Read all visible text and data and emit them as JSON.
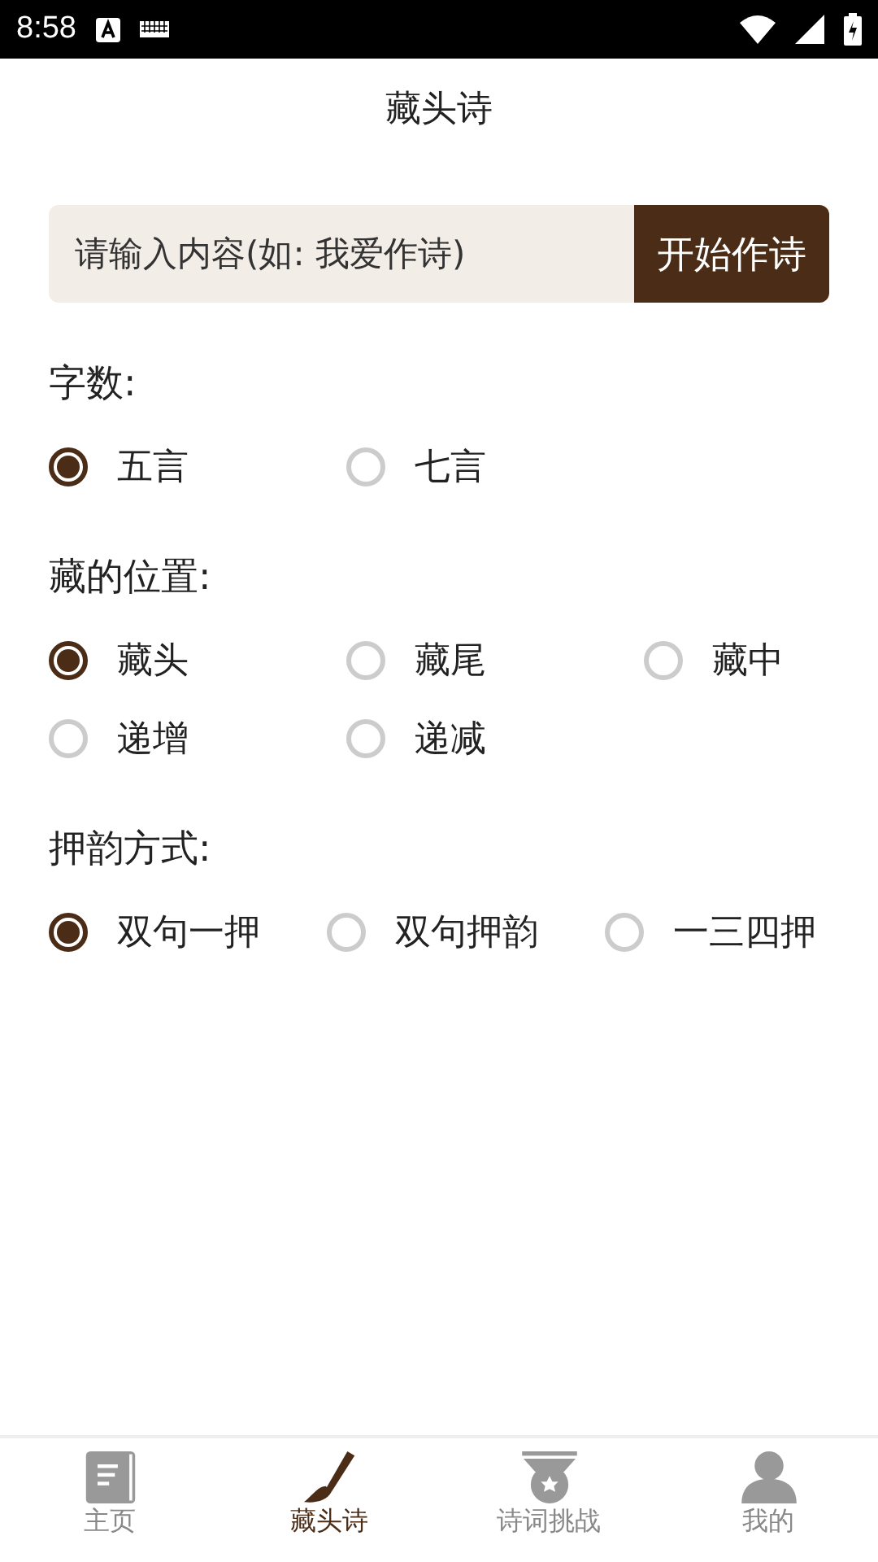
{
  "status_bar": {
    "time": "8:58"
  },
  "header": {
    "title": "藏头诗"
  },
  "input": {
    "placeholder": "请输入内容(如: 我爱作诗)",
    "button": "开始作诗"
  },
  "groups": [
    {
      "label": "字数:",
      "options": [
        {
          "label": "五言",
          "selected": true
        },
        {
          "label": "七言",
          "selected": false
        }
      ]
    },
    {
      "label": "藏的位置:",
      "options": [
        {
          "label": "藏头",
          "selected": true
        },
        {
          "label": "藏尾",
          "selected": false
        },
        {
          "label": "藏中",
          "selected": false
        },
        {
          "label": "递增",
          "selected": false
        },
        {
          "label": "递减",
          "selected": false
        }
      ]
    },
    {
      "label": "押韵方式:",
      "options": [
        {
          "label": "双句一押",
          "selected": true
        },
        {
          "label": "双句押韵",
          "selected": false
        },
        {
          "label": "一三四押",
          "selected": false
        }
      ]
    }
  ],
  "tab_bar": [
    {
      "label": "主页",
      "kind": "book",
      "selected": false
    },
    {
      "label": "藏头诗",
      "kind": "brush",
      "selected": true
    },
    {
      "label": "诗词挑战",
      "kind": "medal",
      "selected": false
    },
    {
      "label": "我的",
      "kind": "person",
      "selected": false
    }
  ]
}
